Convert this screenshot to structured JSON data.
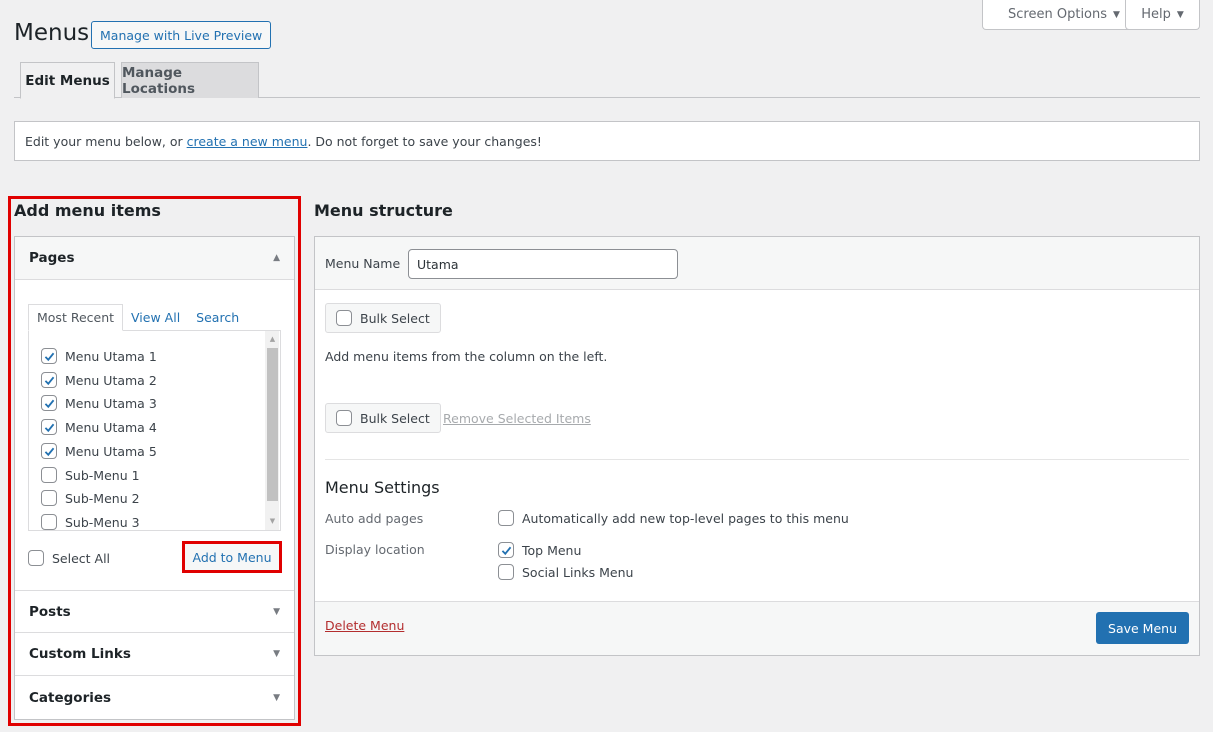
{
  "screen_meta": {
    "screen_options_label": "Screen Options",
    "help_label": "Help"
  },
  "header": {
    "title": "Menus",
    "live_preview_label": "Manage with Live Preview"
  },
  "tabs": [
    {
      "label": "Edit Menus",
      "active": true
    },
    {
      "label": "Manage Locations",
      "active": false
    }
  ],
  "notice": {
    "prefix": "Edit your menu below, or ",
    "link": "create a new menu",
    "suffix": ". Do not forget to save your changes!"
  },
  "left": {
    "title": "Add menu items",
    "pages": {
      "label": "Pages",
      "tabs": [
        "Most Recent",
        "View All",
        "Search"
      ],
      "items": [
        {
          "label": "Menu Utama 1",
          "checked": true
        },
        {
          "label": "Menu Utama 2",
          "checked": true
        },
        {
          "label": "Menu Utama 3",
          "checked": true
        },
        {
          "label": "Menu Utama 4",
          "checked": true
        },
        {
          "label": "Menu Utama 5",
          "checked": true
        },
        {
          "label": "Sub-Menu 1",
          "checked": false
        },
        {
          "label": "Sub-Menu 2",
          "checked": false
        },
        {
          "label": "Sub-Menu 3",
          "checked": false
        }
      ],
      "select_all_label": "Select All",
      "add_to_menu_label": "Add to Menu"
    },
    "sections": [
      {
        "label": "Posts"
      },
      {
        "label": "Custom Links"
      },
      {
        "label": "Categories"
      }
    ]
  },
  "right": {
    "title": "Menu structure",
    "menu_name_label": "Menu Name",
    "menu_name_value": "Utama",
    "bulk_select_label": "Bulk Select",
    "instructions": "Add menu items from the column on the left.",
    "remove_selected_label": "Remove Selected Items",
    "settings": {
      "title": "Menu Settings",
      "auto_add_label": "Auto add pages",
      "auto_add_option": "Automatically add new top-level pages to this menu",
      "auto_add_checked": false,
      "display_location_label": "Display location",
      "locations": [
        {
          "label": "Top Menu",
          "checked": true
        },
        {
          "label": "Social Links Menu",
          "checked": false
        }
      ]
    },
    "delete_label": "Delete Menu",
    "save_label": "Save Menu"
  },
  "colors": {
    "accent": "#2271b1",
    "danger": "#b32d2e",
    "highlight": "#e00000"
  }
}
